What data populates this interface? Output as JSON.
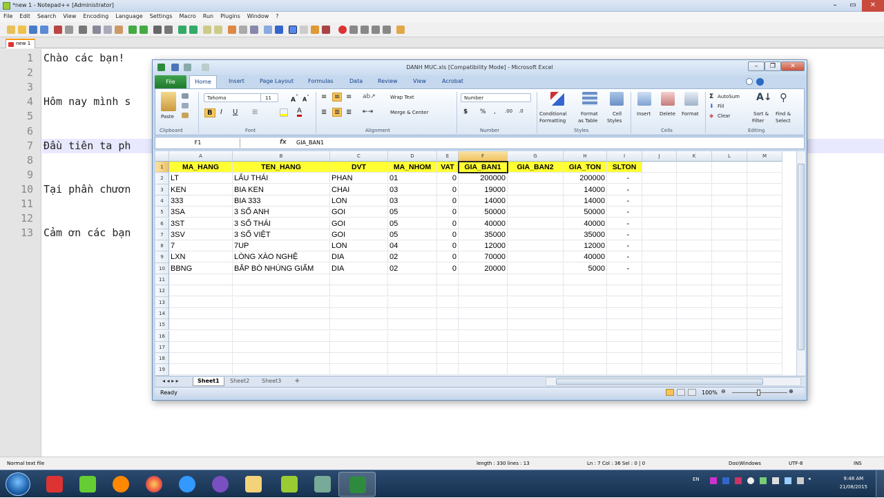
{
  "npp": {
    "title": "*new 1 - Notepad++ [Administrator]",
    "menu": [
      "File",
      "Edit",
      "Search",
      "View",
      "Encoding",
      "Language",
      "Settings",
      "Macro",
      "Run",
      "Plugins",
      "Window",
      "?"
    ],
    "tab_label": "new 1",
    "lines": [
      {
        "n": "1",
        "text": "Chào các bạn!"
      },
      {
        "n": "2",
        "text": ""
      },
      {
        "n": "3",
        "text": ""
      },
      {
        "n": "4",
        "text": "Hôm nay mình s"
      },
      {
        "n": "5",
        "text": ""
      },
      {
        "n": "6",
        "text": ""
      },
      {
        "n": "7",
        "text": "Đầu tiên ta ph"
      },
      {
        "n": "8",
        "text": ""
      },
      {
        "n": "9",
        "text": ""
      },
      {
        "n": "10",
        "text": "Tại phần chươn"
      },
      {
        "n": "11",
        "text": ""
      },
      {
        "n": "12",
        "text": ""
      },
      {
        "n": "13",
        "text": "Cảm ơn các bạn"
      }
    ],
    "status": {
      "type": "Normal text file",
      "length": "length : 330   lines : 13",
      "pos": "Ln : 7   Col : 36   Sel : 0 | 0",
      "eol": "Dos\\Windows",
      "enc": "UTF-8",
      "mode": "INS"
    }
  },
  "excel": {
    "title": "DANH MUC.xls  [Compatibility Mode]  -  Microsoft Excel",
    "tabs": {
      "file": "File",
      "home": "Home",
      "insert": "Insert",
      "layout": "Page Layout",
      "formulas": "Formulas",
      "data": "Data",
      "review": "Review",
      "view": "View",
      "acrobat": "Acrobat"
    },
    "ribbon": {
      "paste": "Paste",
      "font_name": "Tahoma",
      "font_size": "11",
      "wrap": "Wrap Text",
      "merge": "Merge & Center",
      "number_format": "Number",
      "cond": "Conditional",
      "cond2": "Formatting",
      "fmt_table": "Format",
      "fmt_table2": "as Table",
      "cell_styles": "Cell",
      "cell_styles2": "Styles",
      "insert": "Insert",
      "delete": "Delete",
      "format": "Format",
      "autosum": "AutoSum",
      "fill": "Fill",
      "clear": "Clear",
      "sort": "Sort &",
      "sort2": "Filter",
      "find": "Find &",
      "find2": "Select",
      "groups": {
        "clipboard": "Clipboard",
        "font": "Font",
        "alignment": "Alignment",
        "number": "Number",
        "styles": "Styles",
        "cells": "Cells",
        "editing": "Editing"
      }
    },
    "name_box": "F1",
    "fx": "fx",
    "formula": "GIA_BAN1",
    "columns": [
      "A",
      "B",
      "C",
      "D",
      "E",
      "F",
      "G",
      "H",
      "I",
      "J",
      "K",
      "L",
      "M"
    ],
    "headers": [
      "MA_HANG",
      "TEN_HANG",
      "DVT",
      "MA_NHOM",
      "VAT",
      "GIA_BAN1",
      "GIA_BAN2",
      "GIA_TON",
      "SLTON"
    ],
    "rows": [
      [
        "LT",
        "LẨU THÁI",
        "PHAN",
        "01",
        "0",
        "200000",
        "",
        "200000",
        "-"
      ],
      [
        "KEN",
        "BIA KEN",
        "CHAI",
        "03",
        "0",
        "19000",
        "",
        "14000",
        "-"
      ],
      [
        "333",
        "BIA 333",
        "LON",
        "03",
        "0",
        "14000",
        "",
        "14000",
        "-"
      ],
      [
        "3SA",
        "3 SỐ ANH",
        "GOI",
        "05",
        "0",
        "50000",
        "",
        "50000",
        "-"
      ],
      [
        "3ST",
        "3 SỐ THÁI",
        "GOI",
        "05",
        "0",
        "40000",
        "",
        "40000",
        "-"
      ],
      [
        "3SV",
        "3 SỐ VIỆT",
        "GOI",
        "05",
        "0",
        "35000",
        "",
        "35000",
        "-"
      ],
      [
        "7",
        "7UP",
        "LON",
        "04",
        "0",
        "12000",
        "",
        "12000",
        "-"
      ],
      [
        "LXN",
        "LÒNG XÀO NGHỆ",
        "DIA",
        "02",
        "0",
        "70000",
        "",
        "40000",
        "-"
      ],
      [
        "BBNG",
        "BẮP BÒ NHÚNG GIẤM",
        "DIA",
        "02",
        "0",
        "20000",
        "",
        "5000",
        "-"
      ]
    ],
    "row_numbers": [
      "1",
      "2",
      "3",
      "4",
      "5",
      "6",
      "7",
      "8",
      "9",
      "10",
      "11",
      "12",
      "13",
      "14",
      "15",
      "16",
      "17",
      "18",
      "19"
    ],
    "sheets": [
      "Sheet1",
      "Sheet2",
      "Sheet3"
    ],
    "status": "Ready",
    "zoom": "100%"
  },
  "taskbar": {
    "lang": "EN",
    "time": "9:48 AM",
    "date": "21/08/2015"
  }
}
